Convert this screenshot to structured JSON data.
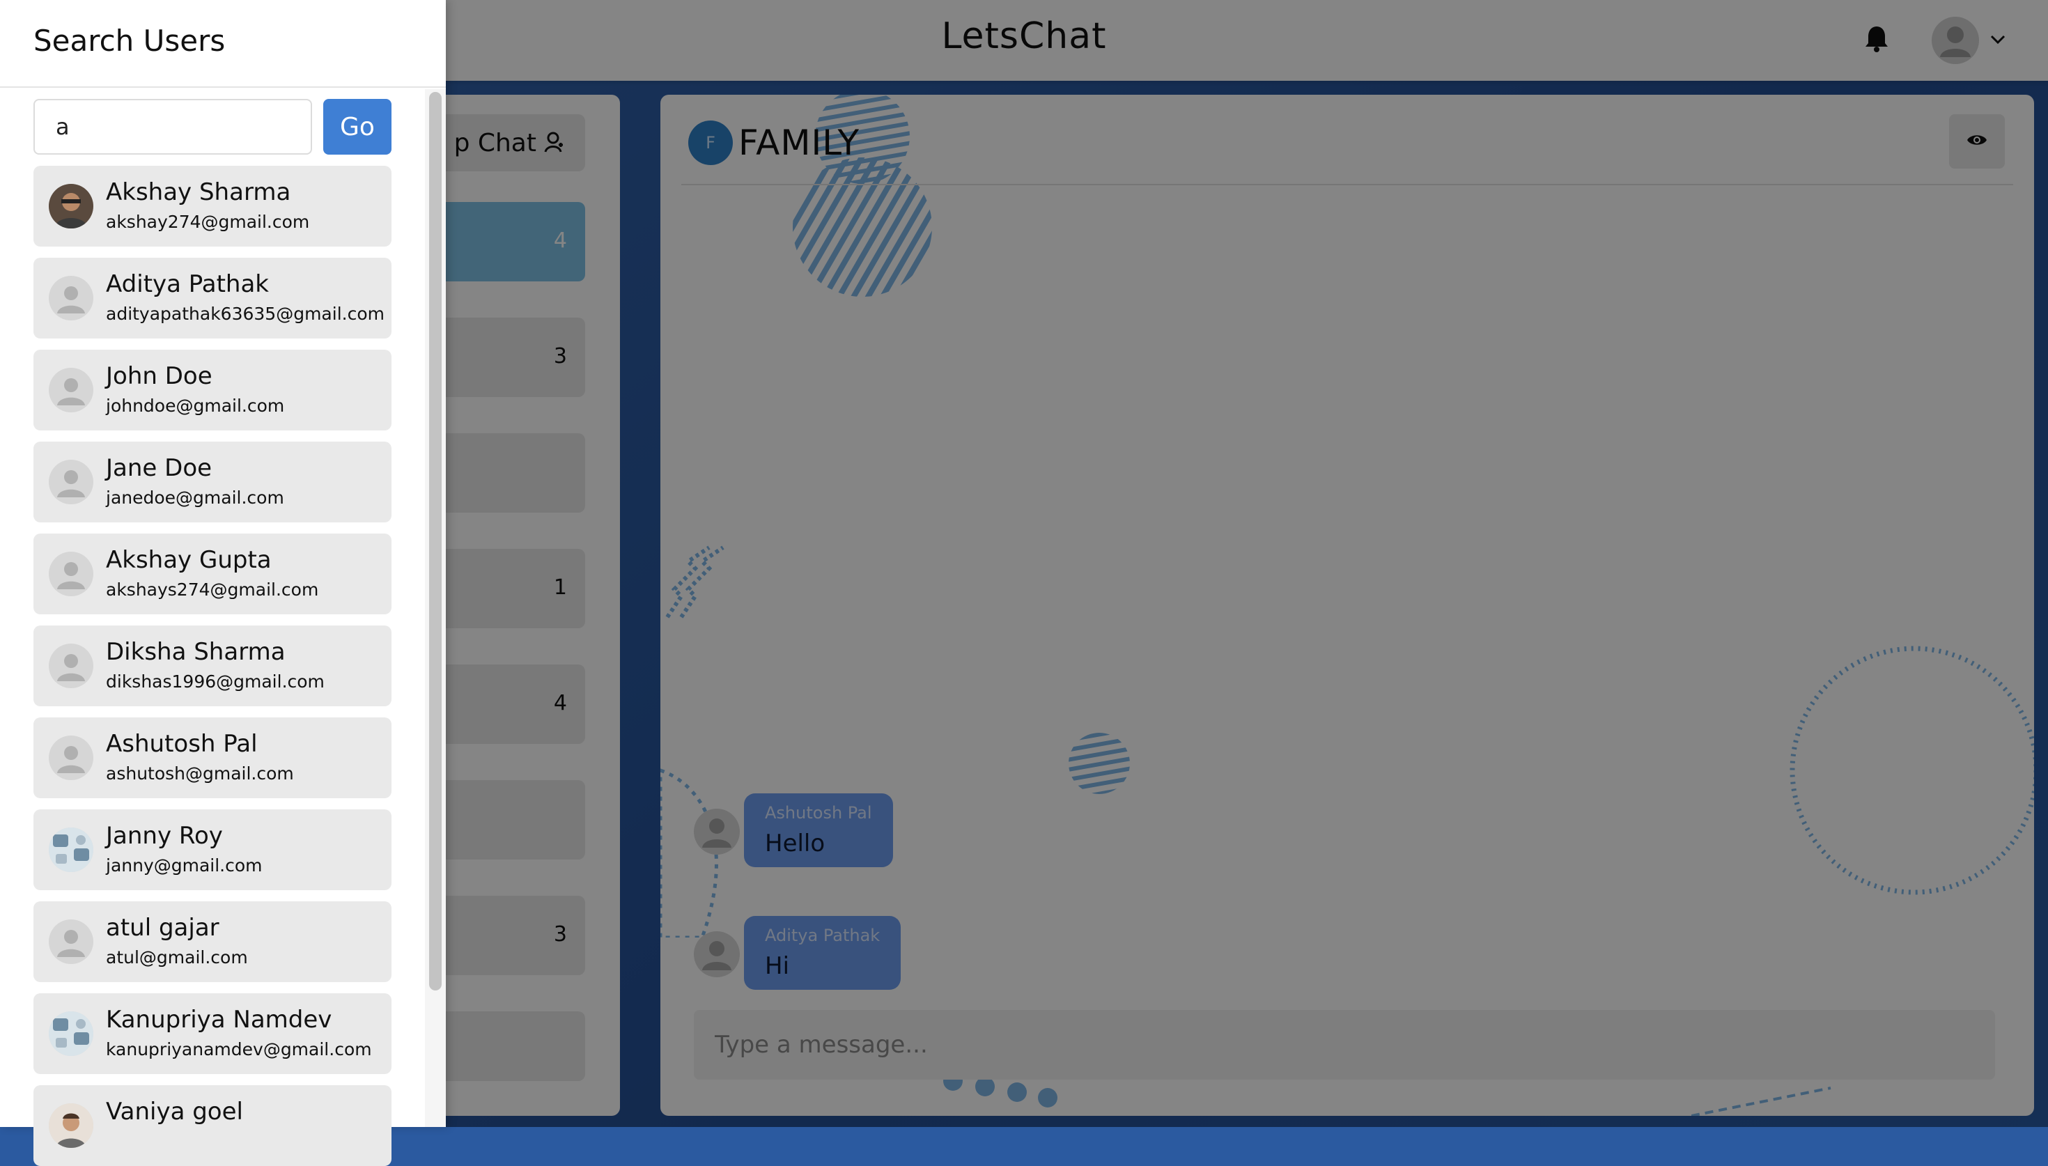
{
  "app": {
    "title": "LetsChat"
  },
  "my_chats": {
    "group_chat_label": "p Chat",
    "items": [
      {
        "count": "4"
      },
      {
        "count": "3"
      },
      {
        "count": ""
      },
      {
        "count": "1"
      },
      {
        "count": "4"
      },
      {
        "count": ""
      },
      {
        "count": "3"
      },
      {
        "count": ""
      }
    ]
  },
  "chat": {
    "avatar_letter": "F",
    "name": "FAMILY",
    "messages": [
      {
        "sender": "Ashutosh Pal",
        "text": "Hello"
      },
      {
        "sender": "Aditya Pathak",
        "text": "Hi"
      }
    ],
    "input_placeholder": "Type a message..."
  },
  "drawer": {
    "title": "Search Users",
    "search_value": "a",
    "go_label": "Go",
    "users": [
      {
        "name": "Akshay Sharma",
        "email": "akshay274@gmail.com",
        "avatar": "photo"
      },
      {
        "name": "Aditya Pathak",
        "email": "adityapathak63635@gmail.com",
        "avatar": "default"
      },
      {
        "name": "John Doe",
        "email": "johndoe@gmail.com",
        "avatar": "default"
      },
      {
        "name": "Jane Doe",
        "email": "janedoe@gmail.com",
        "avatar": "default"
      },
      {
        "name": "Akshay Gupta",
        "email": "akshays274@gmail.com",
        "avatar": "default"
      },
      {
        "name": "Diksha Sharma",
        "email": "dikshas1996@gmail.com",
        "avatar": "default"
      },
      {
        "name": "Ashutosh Pal",
        "email": "ashutosh@gmail.com",
        "avatar": "default"
      },
      {
        "name": "Janny Roy",
        "email": "janny@gmail.com",
        "avatar": "photo"
      },
      {
        "name": "atul gajar",
        "email": "atul@gmail.com",
        "avatar": "default"
      },
      {
        "name": "Kanupriya Namdev",
        "email": "kanupriyanamdev@gmail.com",
        "avatar": "photo"
      },
      {
        "name": "Vaniya goel",
        "email": "",
        "avatar": "photo"
      }
    ]
  },
  "icons": {
    "notification": "bell-icon",
    "profile": "user-avatar-icon",
    "dropdown": "chevron-down-icon",
    "group": "add-group-icon",
    "view": "eye-icon"
  },
  "colors": {
    "accent": "#3f7fd4",
    "bubble": "#6e9ef0",
    "background": "#2b5aa0",
    "active_chat": "#7fc2e6"
  }
}
